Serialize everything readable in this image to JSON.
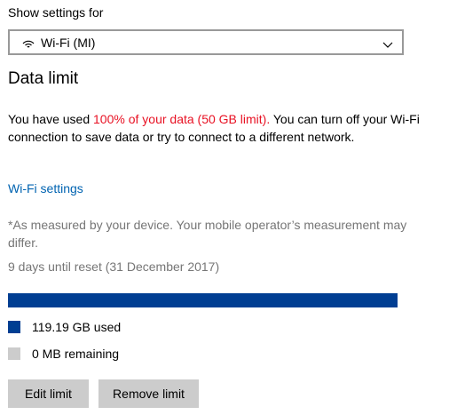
{
  "settings": {
    "show_settings_label": "Show settings for",
    "network": {
      "icon": "wifi-icon",
      "selected": "Wi-Fi (MI)"
    }
  },
  "data_limit": {
    "title": "Data limit",
    "message_prefix": "You have used ",
    "message_highlight": "100% of your data (50 GB limit).",
    "message_suffix": " You can turn off your Wi-Fi connection to save data or try to connect to a different network.",
    "wifi_settings_link": "Wi-Fi settings",
    "measure_note": "*As measured by your device. Your mobile operator’s measurement may differ.",
    "reset_text": "9 days until reset (31 December 2017)",
    "usage_fraction": 1.0,
    "legend": {
      "used": "119.19 GB used",
      "remaining": "0 MB remaining"
    },
    "buttons": {
      "edit": "Edit limit",
      "remove": "Remove limit"
    }
  },
  "colors": {
    "used": "#003e92",
    "remaining": "#cccccc",
    "highlight": "#e81123",
    "link": "#0063b1"
  }
}
